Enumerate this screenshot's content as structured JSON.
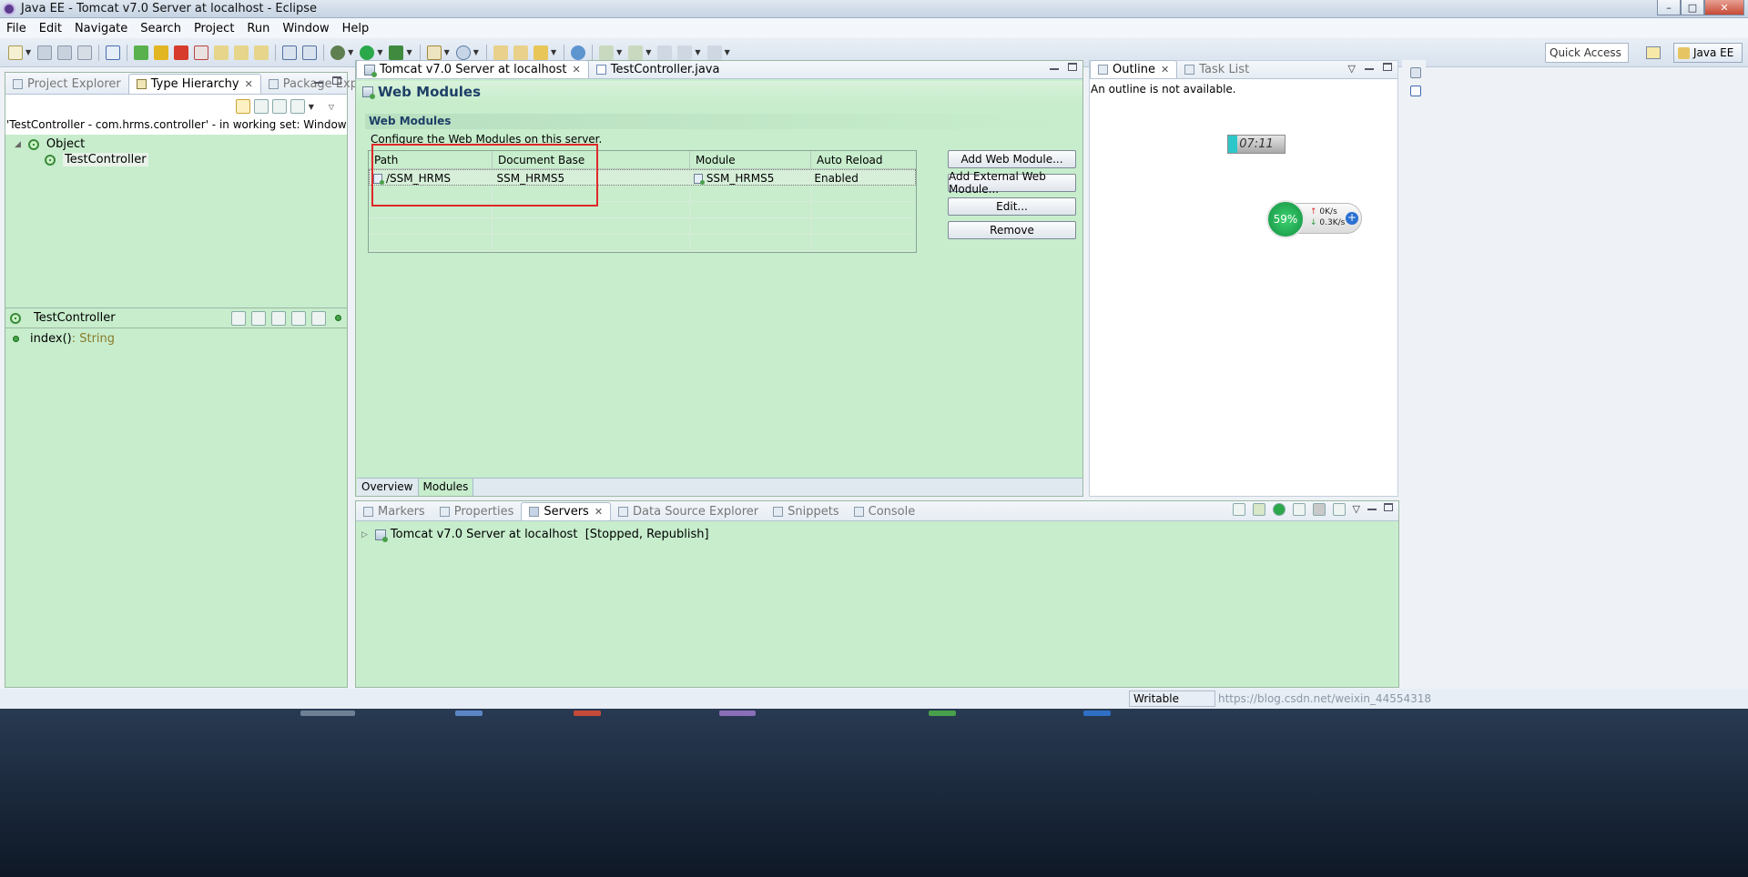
{
  "window": {
    "title": "Java EE - Tomcat v7.0 Server at localhost - Eclipse",
    "controls": [
      "–",
      "□",
      "✕"
    ]
  },
  "menu": [
    "File",
    "Edit",
    "Navigate",
    "Search",
    "Project",
    "Run",
    "Window",
    "Help"
  ],
  "toolbar": {
    "quick_access": "Quick Access",
    "perspective": "Java EE"
  },
  "left_panel": {
    "tabs": [
      {
        "label": "Project Explorer",
        "active": false
      },
      {
        "label": "Type Hierarchy",
        "active": true
      },
      {
        "label": "Package Explorer",
        "active": false
      }
    ],
    "info": "'TestController - com.hrms.controller' - in working set: Window Working Set",
    "tree": [
      {
        "label": "Object",
        "depth": 0,
        "toggle": "◢"
      },
      {
        "label": "TestController",
        "depth": 1
      }
    ],
    "members_title": "TestController",
    "members": [
      {
        "name": "index()",
        "type": " : String"
      }
    ]
  },
  "editor": {
    "tabs": [
      {
        "label": "Tomcat v7.0 Server at localhost",
        "active": true
      },
      {
        "label": "TestController.java",
        "active": false
      }
    ],
    "title": "Web Modules",
    "section_title": "Web Modules",
    "section_desc": "Configure the Web Modules on this server.",
    "table": {
      "columns": [
        "Path",
        "Document Base",
        "Module",
        "Auto Reload"
      ],
      "rows": [
        {
          "path": "/SSM_HRMS",
          "doc_base": "SSM_HRMS5",
          "module": "SSM_HRMS5",
          "auto_reload": "Enabled"
        }
      ]
    },
    "buttons": {
      "add_web_module": "Add Web Module...",
      "add_external": "Add External Web Module...",
      "edit": "Edit...",
      "remove": "Remove"
    },
    "bottom_tabs": [
      {
        "label": "Overview",
        "active": false
      },
      {
        "label": "Modules",
        "active": true
      }
    ]
  },
  "outline": {
    "tabs": [
      {
        "label": "Outline",
        "active": true
      },
      {
        "label": "Task List",
        "active": false
      }
    ],
    "message": "An outline is not available.",
    "clock": "07:11",
    "net_percent": "59%",
    "net_up": "0K/s",
    "net_down": "0.3K/s"
  },
  "bottom_panel": {
    "tabs": [
      {
        "label": "Markers",
        "active": false
      },
      {
        "label": "Properties",
        "active": false
      },
      {
        "label": "Servers",
        "active": true
      },
      {
        "label": "Data Source Explorer",
        "active": false
      },
      {
        "label": "Snippets",
        "active": false
      },
      {
        "label": "Console",
        "active": false
      }
    ],
    "server_row": "Tomcat v7.0 Server at localhost  [Stopped, Republish]"
  },
  "status": {
    "writable": "Writable",
    "watermark": "https://blog.csdn.net/weixin_44554318"
  }
}
